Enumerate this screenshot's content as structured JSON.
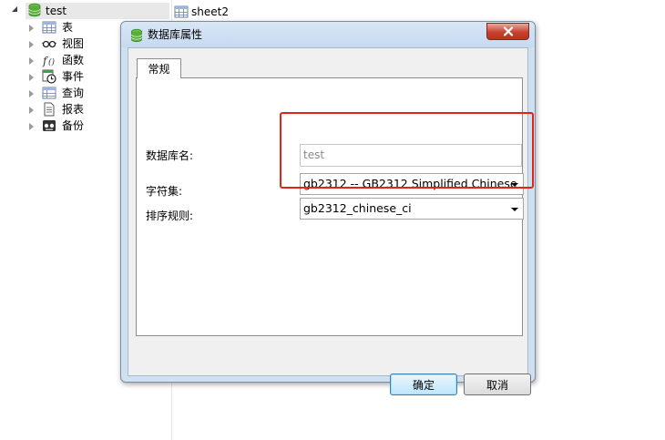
{
  "tree": {
    "root": {
      "label": "test",
      "icon": "database-icon"
    },
    "children": [
      {
        "label": "表",
        "icon": "table-icon"
      },
      {
        "label": "视图",
        "icon": "view-icon"
      },
      {
        "label": "函数",
        "icon": "function-icon"
      },
      {
        "label": "事件",
        "icon": "event-icon"
      },
      {
        "label": "查询",
        "icon": "query-icon"
      },
      {
        "label": "报表",
        "icon": "report-icon"
      },
      {
        "label": "备份",
        "icon": "backup-icon"
      }
    ]
  },
  "editor_tab": {
    "label": "sheet2",
    "icon": "table-icon"
  },
  "dialog": {
    "title": "数据库属性",
    "tab": "常规",
    "fields": {
      "db_name_label": "数据库名:",
      "db_name_value": "test",
      "charset_label": "字符集:",
      "charset_value": "gb2312 -- GB2312 Simplified Chinese",
      "collation_label": "排序规则:",
      "collation_value": "gb2312_chinese_ci"
    },
    "ok_label": "确定",
    "cancel_label": "取消"
  },
  "colors": {
    "highlight": "#e2231a",
    "close_button": "#c7412f",
    "database_icon": "#4caf50"
  }
}
